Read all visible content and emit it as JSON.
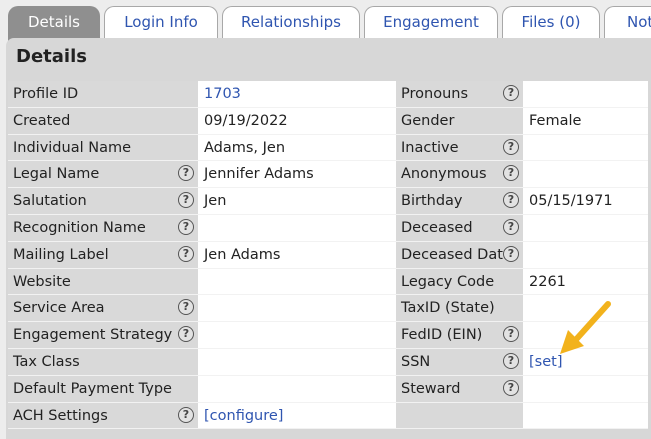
{
  "tabs": [
    {
      "label": "Details"
    },
    {
      "label": "Login Info"
    },
    {
      "label": "Relationships"
    },
    {
      "label": "Engagement"
    },
    {
      "label": "Files (0)"
    },
    {
      "label": "Not"
    }
  ],
  "panel": {
    "title": "Details"
  },
  "left_fields": [
    {
      "label": "Profile ID",
      "value": "1703"
    },
    {
      "label": "Created",
      "value": "09/19/2022"
    },
    {
      "label": "Individual Name",
      "value": "Adams, Jen"
    },
    {
      "label": "Legal Name",
      "value": "Jennifer Adams"
    },
    {
      "label": "Salutation",
      "value": "Jen"
    },
    {
      "label": "Recognition Name",
      "value": ""
    },
    {
      "label": "Mailing Label",
      "value": "Jen Adams"
    },
    {
      "label": "Website",
      "value": ""
    },
    {
      "label": "Service Area",
      "value": ""
    },
    {
      "label": "Engagement Strategy",
      "value": ""
    },
    {
      "label": "Tax Class",
      "value": ""
    },
    {
      "label": "Default Payment Type",
      "value": ""
    },
    {
      "label": "ACH Settings",
      "value": "[configure]"
    }
  ],
  "right_fields": [
    {
      "label": "Pronouns",
      "value": ""
    },
    {
      "label": "Gender",
      "value": "Female"
    },
    {
      "label": "Inactive",
      "value": ""
    },
    {
      "label": "Anonymous",
      "value": ""
    },
    {
      "label": "Birthday",
      "value": "05/15/1971"
    },
    {
      "label": "Deceased",
      "value": ""
    },
    {
      "label": "Deceased Date",
      "value": ""
    },
    {
      "label": "Legacy Code",
      "value": "2261"
    },
    {
      "label": "TaxID (State)",
      "value": ""
    },
    {
      "label": "FedID (EIN)",
      "value": ""
    },
    {
      "label": "SSN",
      "value": "[set]"
    },
    {
      "label": "Steward",
      "value": ""
    },
    {
      "label": "",
      "value": ""
    }
  ],
  "help_glyph": "?",
  "colors": {
    "link": "#2f55b0",
    "arrow": "#f2b21c",
    "active_tab": "#8f8f8f"
  }
}
